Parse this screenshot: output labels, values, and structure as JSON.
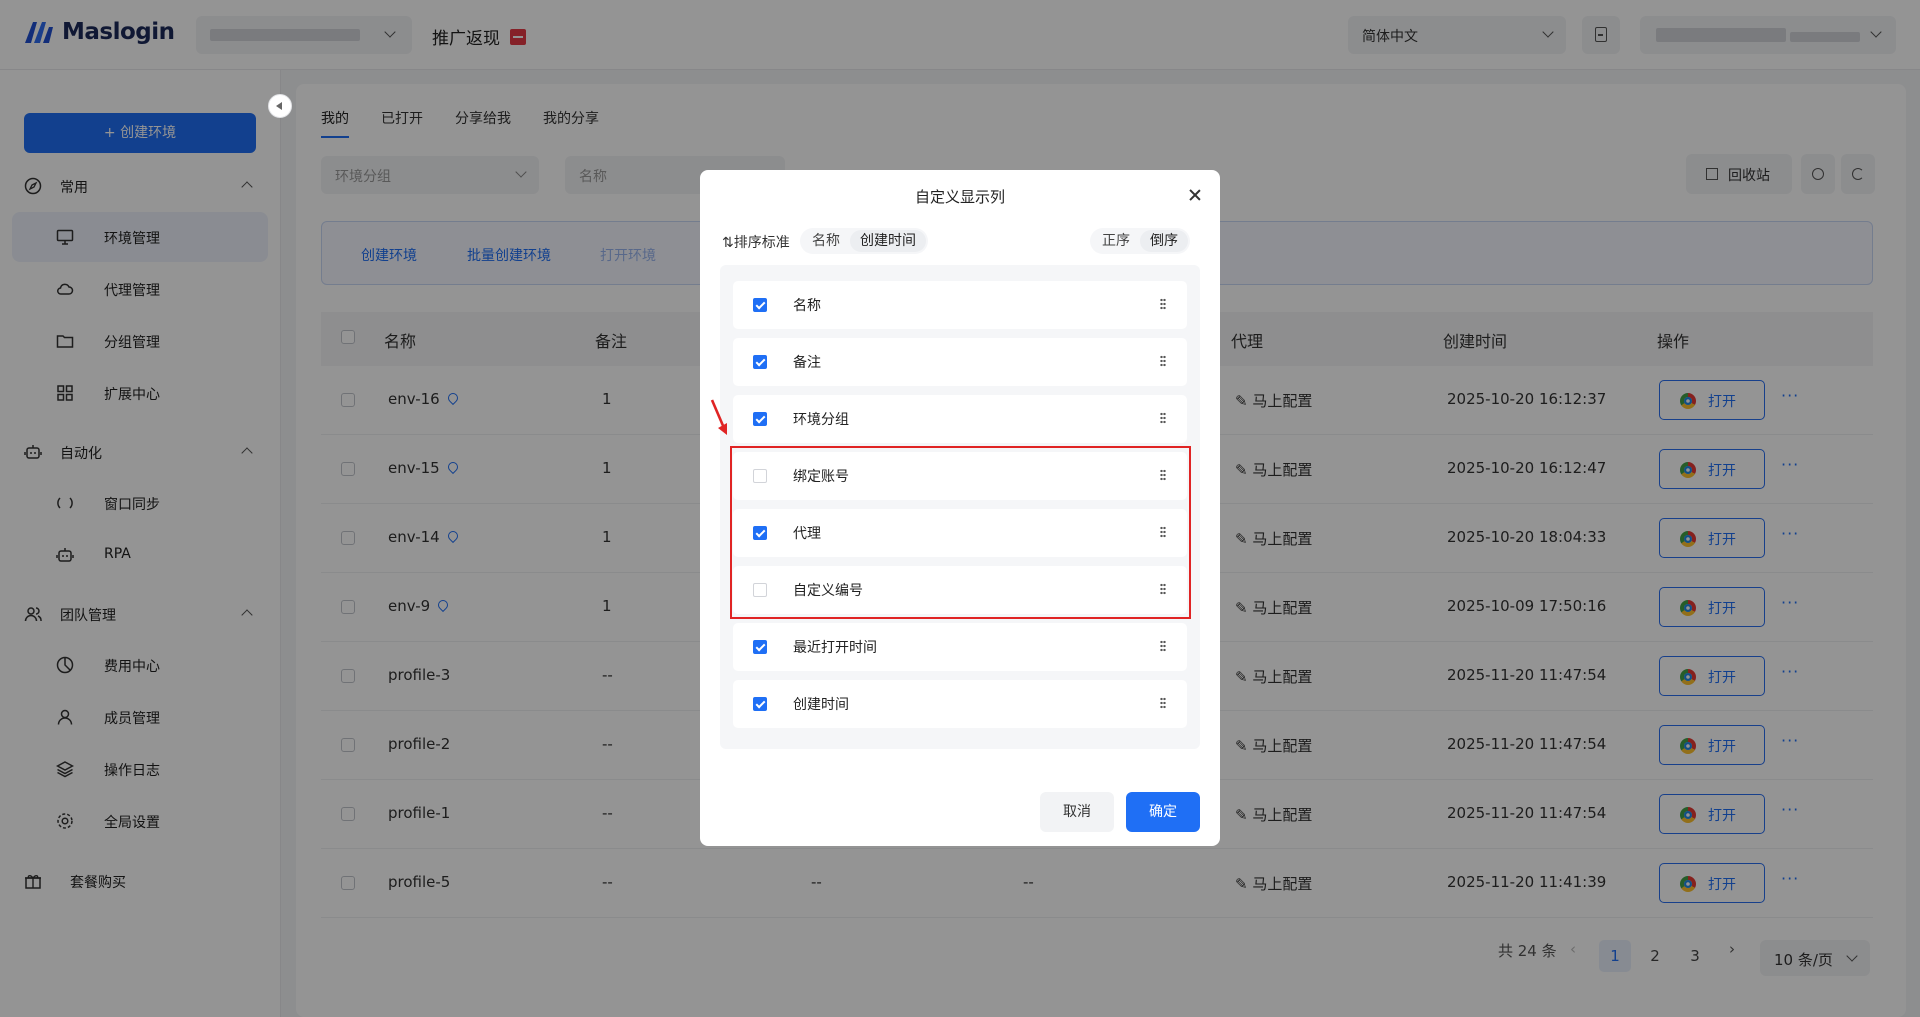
{
  "header": {
    "logo_text": "Maslogin",
    "promo_label": "推广返现",
    "language": "简体中文"
  },
  "sidebar": {
    "create_button": "+ 创建环境",
    "sections": [
      {
        "label": "常用",
        "items": [
          "环境管理",
          "代理管理",
          "分组管理",
          "扩展中心"
        ]
      },
      {
        "label": "自动化",
        "items": [
          "窗口同步",
          "RPA"
        ]
      },
      {
        "label": "团队管理",
        "items": [
          "费用中心",
          "成员管理",
          "操作日志",
          "全局设置"
        ]
      }
    ],
    "buy_label": "套餐购买"
  },
  "tabs": [
    "我的",
    "已打开",
    "分享给我",
    "我的分享"
  ],
  "filters": {
    "group_placeholder": "环境分组",
    "name_placeholder": "名称"
  },
  "toolbar": {
    "recycle_bin": "回收站"
  },
  "actions": [
    "创建环境",
    "批量创建环境",
    "打开环境"
  ],
  "table": {
    "headers": {
      "name": "名称",
      "remark": "备注",
      "proxy": "代理",
      "created": "创建时间",
      "ops": "操作"
    },
    "config_label": "马上配置",
    "open_label": "打开",
    "more_label": "···",
    "rows": [
      {
        "name": "env-16",
        "pinned": true,
        "remark": "1",
        "c3": "",
        "c4": "",
        "created": "2025-10-20 16:12:37"
      },
      {
        "name": "env-15",
        "pinned": true,
        "remark": "1",
        "c3": "",
        "c4": "",
        "created": "2025-10-20 16:12:47"
      },
      {
        "name": "env-14",
        "pinned": true,
        "remark": "1",
        "c3": "",
        "c4": "",
        "created": "2025-10-20 18:04:33"
      },
      {
        "name": "env-9",
        "pinned": true,
        "remark": "1",
        "c3": "",
        "c4": "",
        "created": "2025-10-09 17:50:16"
      },
      {
        "name": "profile-3",
        "pinned": false,
        "remark": "--",
        "c3": "",
        "c4": "",
        "created": "2025-11-20 11:47:54"
      },
      {
        "name": "profile-2",
        "pinned": false,
        "remark": "--",
        "c3": "",
        "c4": "",
        "created": "2025-11-20 11:47:54"
      },
      {
        "name": "profile-1",
        "pinned": false,
        "remark": "--",
        "c3": "",
        "c4": "",
        "created": "2025-11-20 11:47:54"
      },
      {
        "name": "profile-5",
        "pinned": false,
        "remark": "--",
        "c3": "--",
        "c4": "--",
        "created": "2025-11-20 11:41:39"
      }
    ]
  },
  "pagination": {
    "total": "共 24 条",
    "pages": [
      "1",
      "2",
      "3"
    ],
    "current": "1",
    "page_size": "10 条/页"
  },
  "modal": {
    "title": "自定义显示列",
    "sort_label": "排序标准",
    "sort_by": [
      "名称",
      "创建时间"
    ],
    "sort_by_selected": "创建时间",
    "order": [
      "正序",
      "倒序"
    ],
    "order_selected": "倒序",
    "columns": [
      {
        "label": "名称",
        "checked": true
      },
      {
        "label": "备注",
        "checked": true
      },
      {
        "label": "环境分组",
        "checked": true
      },
      {
        "label": "绑定账号",
        "checked": false
      },
      {
        "label": "代理",
        "checked": true
      },
      {
        "label": "自定义编号",
        "checked": false
      },
      {
        "label": "最近打开时间",
        "checked": true
      },
      {
        "label": "创建时间",
        "checked": true
      }
    ],
    "cancel": "取消",
    "confirm": "确定"
  },
  "colors": {
    "primary": "#1f6ff5",
    "highlight_box": "#e02424"
  }
}
